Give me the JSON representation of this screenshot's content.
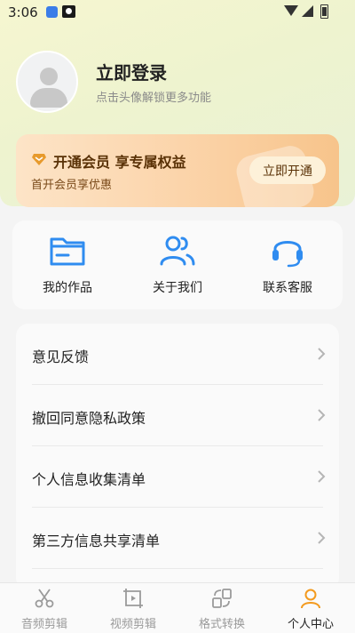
{
  "status_bar": {
    "time": "3:06"
  },
  "profile": {
    "title": "立即登录",
    "subtitle": "点击头像解锁更多功能"
  },
  "vip": {
    "title": "开通会员 享专属权益",
    "subtitle": "首开会员享优惠",
    "button": "立即开通"
  },
  "quick_actions": [
    {
      "label": "我的作品",
      "icon": "folder-icon"
    },
    {
      "label": "关于我们",
      "icon": "users-icon"
    },
    {
      "label": "联系客服",
      "icon": "headset-icon"
    }
  ],
  "menu": [
    {
      "label": "意见反馈"
    },
    {
      "label": "撤回同意隐私政策"
    },
    {
      "label": "个人信息收集清单"
    },
    {
      "label": "第三方信息共享清单"
    }
  ],
  "tabs": [
    {
      "label": "音频剪辑",
      "icon": "scissors-icon"
    },
    {
      "label": "视频剪辑",
      "icon": "video-clip-icon"
    },
    {
      "label": "格式转换",
      "icon": "convert-icon"
    },
    {
      "label": "个人中心",
      "icon": "person-icon"
    }
  ],
  "colors": {
    "accent_blue": "#2f8cf0",
    "vip_gold": "#e79a2c",
    "active_tab": "#f39a1e"
  }
}
